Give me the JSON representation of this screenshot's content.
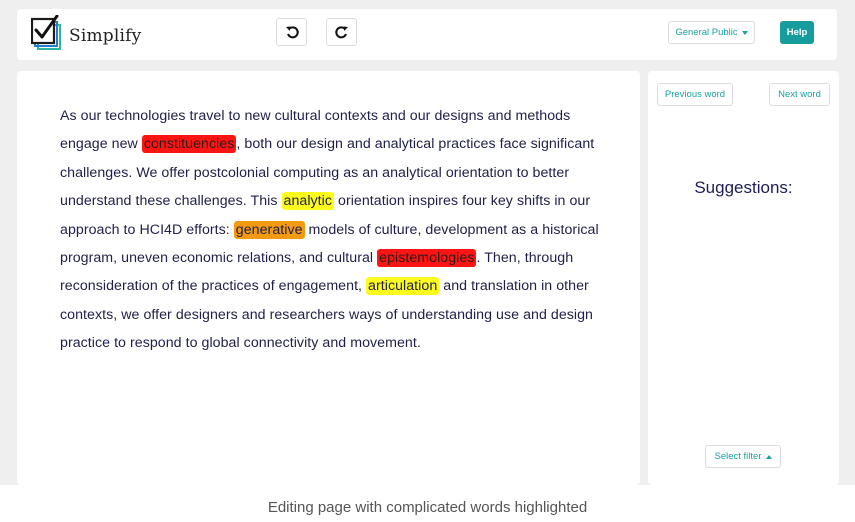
{
  "header": {
    "app_name": "Simplify",
    "audience_label": "General Public",
    "help_label": "Help"
  },
  "icons": {
    "logo": "checkbox-check-icon",
    "undo": "undo-icon",
    "redo": "redo-icon",
    "dropdown": "caret-down-icon",
    "filter": "caret-up-icon"
  },
  "editor": {
    "segments": [
      {
        "text": "As our technologies travel to new cultural contexts and our designs and methods engage new "
      },
      {
        "text": "constituencies",
        "highlight": "red"
      },
      {
        "text": ", both our design and analytical practices face significant challenges. We offer postcolonial computing as an analytical orientation to better understand these challenges. This "
      },
      {
        "text": "analytic",
        "highlight": "yellow"
      },
      {
        "text": " orientation inspires four key shifts in our approach to HCI4D efforts: "
      },
      {
        "text": "generative",
        "highlight": "orange"
      },
      {
        "text": " models of culture, development as a historical program, uneven economic relations, and cultural "
      },
      {
        "text": "epistemologies",
        "highlight": "red"
      },
      {
        "text": ". Then, through reconsideration of the practices of engagement, "
      },
      {
        "text": "articulation",
        "highlight": "yellow"
      },
      {
        "text": " and translation in other contexts, we offer designers and researchers ways of understanding use and design practice to respond to global connectivity and movement."
      }
    ]
  },
  "sidebar": {
    "previous_label": "Previous word",
    "next_label": "Next word",
    "suggestions_title": "Suggestions:",
    "filter_label": "Select filter"
  },
  "caption": "Editing page with complicated words highlighted",
  "colors": {
    "accent": "#169c9c",
    "highlight_red": "#ff1414",
    "highlight_yellow": "#fcfc1e",
    "highlight_orange": "#f39a13",
    "text": "#1f1f4a"
  }
}
